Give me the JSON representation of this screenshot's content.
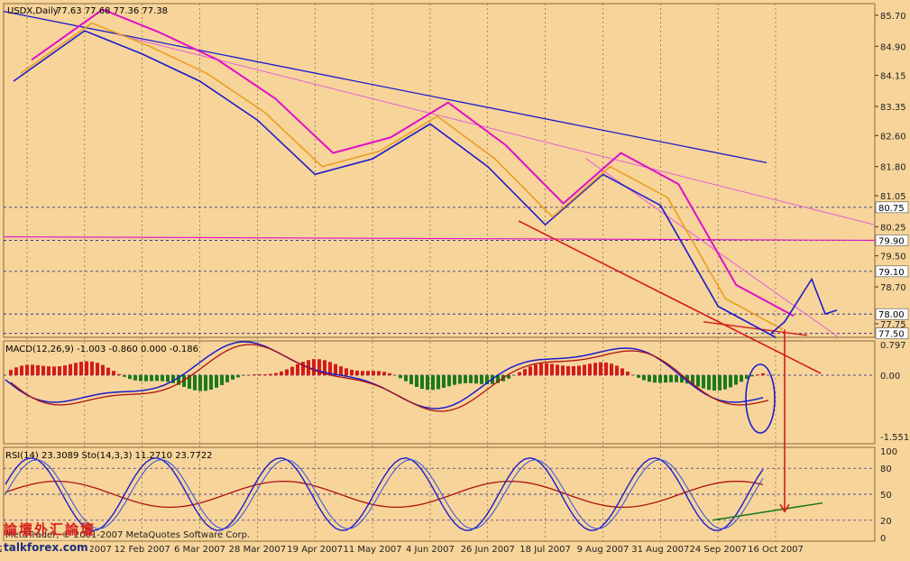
{
  "chart_data": {
    "type": "line",
    "symbol": "USDX,Daily",
    "ohlc_readout": "77.63 77.68 77.36 77.38",
    "price_axis": {
      "ticks": [
        "85.70",
        "84.90",
        "84.15",
        "83.35",
        "82.60",
        "81.80",
        "81.05",
        "80.25",
        "79.50",
        "78.70",
        "77.75"
      ],
      "marked_levels": [
        {
          "label": "80.75",
          "value": 80.75
        },
        {
          "label": "79.90",
          "value": 79.9
        },
        {
          "label": "79.10",
          "value": 79.1
        },
        {
          "label": "78.00",
          "value": 78.0
        },
        {
          "label": "77.50",
          "value": 77.5
        }
      ],
      "ylim": [
        77.4,
        86.0
      ]
    },
    "macd_panel": {
      "label": "MACD(12,26,9) -1.003 -0.860 0.000 -0.186",
      "ticks": [
        "0.797",
        "0.00",
        "-1.551"
      ]
    },
    "rsi_panel": {
      "label": "RSI(14) 23.3089 Sto(14,3,3) 11.2710 23.7722",
      "ticks": [
        "100",
        "80",
        "50",
        "20",
        "0"
      ]
    },
    "x_ticks": [
      "27 Dec 2006",
      "19 Jan 2007",
      "12 Feb 2007",
      "6 Mar 2007",
      "28 Mar 2007",
      "19 Apr 2007",
      "11 May 2007",
      "4 Jun 2007",
      "26 Jun 2007",
      "18 Jul 2007",
      "9 Aug 2007",
      "31 Aug 2007",
      "24 Sep 2007",
      "16 Oct 2007"
    ],
    "price_series": [
      {
        "date": "27 Dec 2006",
        "value": 84.0
      },
      {
        "date": "19 Jan 2007",
        "value": 85.3
      },
      {
        "date": "12 Feb 2007",
        "value": 84.7
      },
      {
        "date": "6 Mar 2007",
        "value": 84.0
      },
      {
        "date": "28 Mar 2007",
        "value": 83.0
      },
      {
        "date": "19 Apr 2007",
        "value": 81.6
      },
      {
        "date": "11 May 2007",
        "value": 82.0
      },
      {
        "date": "4 Jun 2007",
        "value": 82.9
      },
      {
        "date": "26 Jun 2007",
        "value": 81.8
      },
      {
        "date": "18 Jul 2007",
        "value": 80.3
      },
      {
        "date": "9 Aug 2007",
        "value": 81.6
      },
      {
        "date": "31 Aug 2007",
        "value": 80.8
      },
      {
        "date": "24 Sep 2007",
        "value": 78.2
      },
      {
        "date": "16 Oct 2007",
        "value": 77.4
      }
    ],
    "grid": "dotted",
    "colors": {
      "background": "#f7d49a",
      "price": "#1c1ccc",
      "signal": "#b01010",
      "macd_pos": "#d41c1c",
      "macd_neg": "#1c7a1c",
      "ema": "#e8a020",
      "ma_long": "#e010c8",
      "channel": "#1c1ccc",
      "trend": "#d41c1c"
    }
  },
  "watermark": {
    "site_cn": "論壇外汇論壇",
    "brand": "talkforex.com",
    "copyright": "MetaTrader, © 2001-2007 MetaQuotes Software Corp."
  }
}
